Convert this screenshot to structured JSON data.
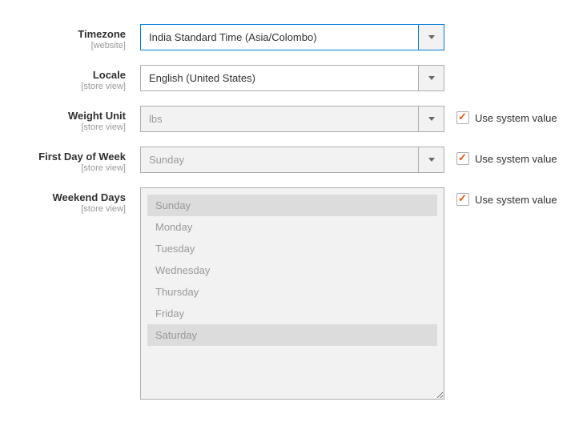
{
  "system_value_label": "Use system value",
  "fields": {
    "timezone": {
      "label": "Timezone",
      "scope": "[website]",
      "value": "India Standard Time (Asia/Colombo)"
    },
    "locale": {
      "label": "Locale",
      "scope": "[store view]",
      "value": "English (United States)"
    },
    "weight_unit": {
      "label": "Weight Unit",
      "scope": "[store view]",
      "value": "lbs"
    },
    "first_day": {
      "label": "First Day of Week",
      "scope": "[store view]",
      "value": "Sunday"
    },
    "weekend_days": {
      "label": "Weekend Days",
      "scope": "[store view]",
      "options": [
        {
          "label": "Sunday",
          "selected": true
        },
        {
          "label": "Monday",
          "selected": false
        },
        {
          "label": "Tuesday",
          "selected": false
        },
        {
          "label": "Wednesday",
          "selected": false
        },
        {
          "label": "Thursday",
          "selected": false
        },
        {
          "label": "Friday",
          "selected": false
        },
        {
          "label": "Saturday",
          "selected": true
        }
      ]
    }
  }
}
